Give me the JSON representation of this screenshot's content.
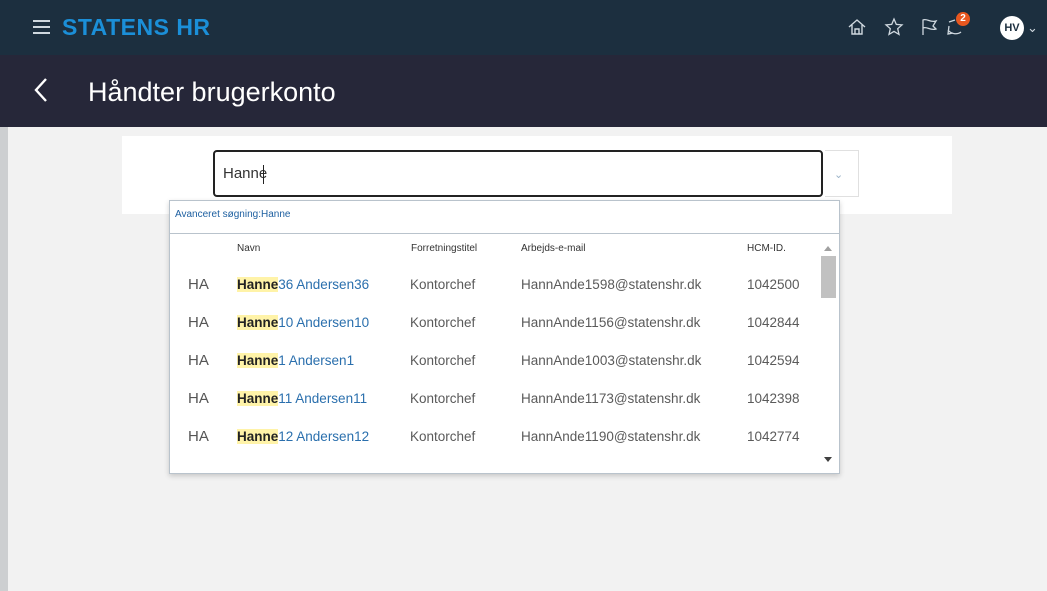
{
  "header": {
    "brand": "STATENS HR",
    "icons": [
      "home-icon",
      "star-icon",
      "flag-icon",
      "notifications-icon"
    ],
    "notification_count": "2",
    "avatar_initials": "HV"
  },
  "page": {
    "title": "Håndter brugerkonto"
  },
  "search": {
    "value": "Hanne"
  },
  "dropdown": {
    "advanced_search": "Avanceret søgning:Hanne",
    "columns": {
      "name": "Navn",
      "title": "Forretningstitel",
      "email": "Arbejds-e-mail",
      "id": "HCM-ID."
    },
    "rows": [
      {
        "initials": "HA",
        "name_hl": "Hanne",
        "name_rest": "36 Andersen36",
        "title": "Kontorchef",
        "email": "HannAnde1598@statenshr.dk",
        "id": "1042500"
      },
      {
        "initials": "HA",
        "name_hl": "Hanne",
        "name_rest": "10 Andersen10",
        "title": "Kontorchef",
        "email": "HannAnde1156@statenshr.dk",
        "id": "1042844"
      },
      {
        "initials": "HA",
        "name_hl": "Hanne",
        "name_rest": "1 Andersen1",
        "title": "Kontorchef",
        "email": "HannAnde1003@statenshr.dk",
        "id": "1042594"
      },
      {
        "initials": "HA",
        "name_hl": "Hanne",
        "name_rest": "11 Andersen11",
        "title": "Kontorchef",
        "email": "HannAnde1173@statenshr.dk",
        "id": "1042398"
      },
      {
        "initials": "HA",
        "name_hl": "Hanne",
        "name_rest": "12 Andersen12",
        "title": "Kontorchef",
        "email": "HannAnde1190@statenshr.dk",
        "id": "1042774"
      }
    ]
  },
  "colors": {
    "topbar": "#1c2f3f",
    "subbar": "#262739",
    "brand": "#1b8fd8",
    "link": "#2a6fad",
    "highlight": "#fff3a8",
    "badge": "#e8571f"
  }
}
